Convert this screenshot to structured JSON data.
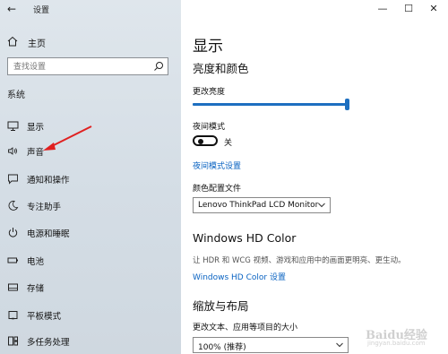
{
  "window": {
    "title": "设置",
    "controls": {
      "minimize": "—",
      "maximize": "☐",
      "close": "✕"
    }
  },
  "sidebar": {
    "home_label": "主页",
    "search_placeholder": "查找设置",
    "section_label": "系统",
    "items": [
      {
        "label": "显示",
        "icon": "monitor-icon"
      },
      {
        "label": "声音",
        "icon": "speaker-icon"
      },
      {
        "label": "通知和操作",
        "icon": "notification-icon"
      },
      {
        "label": "专注助手",
        "icon": "moon-icon"
      },
      {
        "label": "电源和睡眠",
        "icon": "power-icon"
      },
      {
        "label": "电池",
        "icon": "battery-icon"
      },
      {
        "label": "存储",
        "icon": "storage-icon"
      },
      {
        "label": "平板模式",
        "icon": "tablet-icon"
      },
      {
        "label": "多任务处理",
        "icon": "multitask-icon"
      }
    ]
  },
  "main": {
    "page_title": "显示",
    "brightness_section": "亮度和颜色",
    "brightness_label": "更改亮度",
    "brightness_value": 0.98,
    "night_mode_label": "夜间模式",
    "night_mode_state": "关",
    "night_mode_link": "夜间模式设置",
    "color_profile_label": "颜色配置文件",
    "color_profile_value": "Lenovo ThinkPad LCD Monitor",
    "hd_color_heading": "Windows HD Color",
    "hd_color_desc": "让 HDR 和 WCG 视频、游戏和应用中的画面更明亮、更生动。",
    "hd_color_link": "Windows HD Color 设置",
    "scale_section": "缩放与布局",
    "scale_label": "更改文本、应用等项目的大小",
    "scale_value": "100% (推荐)"
  },
  "watermark": {
    "text": "Baidu经验",
    "sub": "jingyan.baidu.com"
  },
  "colors": {
    "accent": "#1e6fc0",
    "link": "#0a63c2",
    "sidebar_bg": "#d8e0e7",
    "arrow": "#e02020"
  }
}
